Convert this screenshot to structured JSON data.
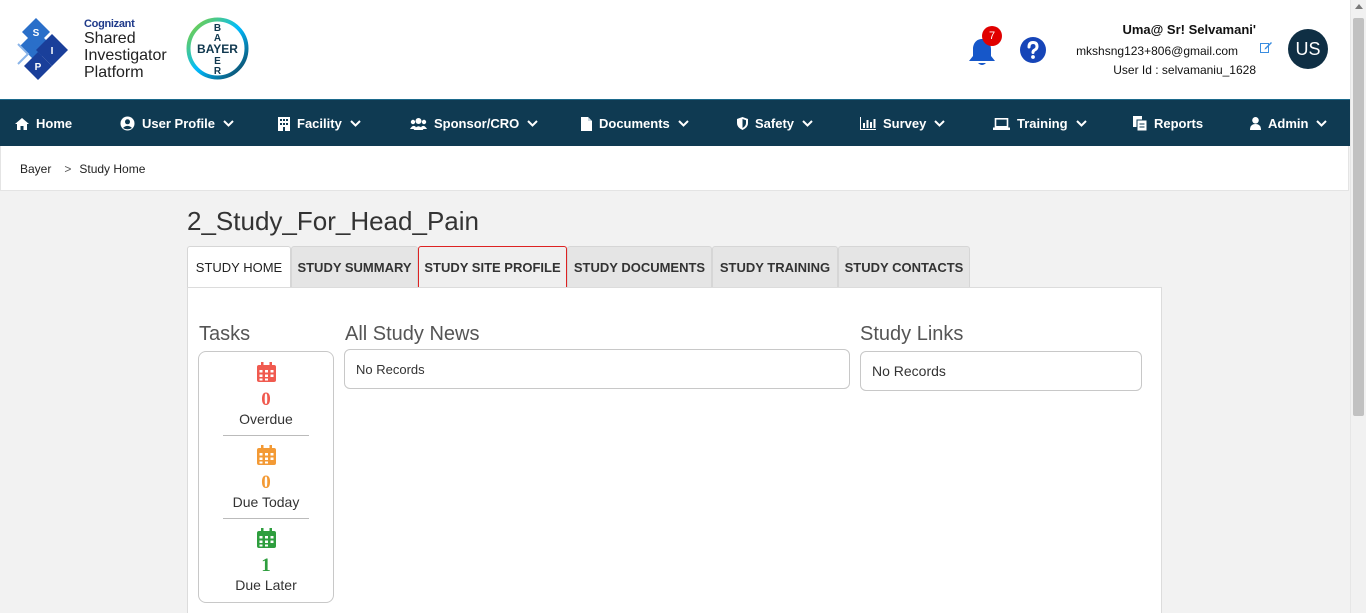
{
  "header": {
    "brand_company": "Cognizant",
    "brand_line1": "Shared",
    "brand_line2": "Investigator",
    "brand_line3": "Platform",
    "sip_letters": [
      "S",
      "I",
      "P"
    ],
    "partner_logo_text": "BAYER",
    "notification_count": "7",
    "user_name": "Uma@ Sr! Selvamani'",
    "user_email": "mkshsng123+806@gmail.com",
    "user_id": "User Id : selvamaniu_1628",
    "avatar_initials": "US"
  },
  "nav": {
    "items": [
      {
        "label": "Home",
        "icon": "home-icon",
        "dropdown": false
      },
      {
        "label": "User Profile",
        "icon": "user-circle-icon",
        "dropdown": true
      },
      {
        "label": "Facility",
        "icon": "building-icon",
        "dropdown": true
      },
      {
        "label": "Sponsor/CRO",
        "icon": "users-icon",
        "dropdown": true
      },
      {
        "label": "Documents",
        "icon": "file-icon",
        "dropdown": true
      },
      {
        "label": "Safety",
        "icon": "shield-icon",
        "dropdown": true
      },
      {
        "label": "Survey",
        "icon": "bar-chart-icon",
        "dropdown": true
      },
      {
        "label": "Training",
        "icon": "laptop-icon",
        "dropdown": true
      },
      {
        "label": "Reports",
        "icon": "copy-icon",
        "dropdown": false
      },
      {
        "label": "Admin",
        "icon": "user-icon",
        "dropdown": true
      }
    ]
  },
  "breadcrumb": {
    "root": "Bayer",
    "separator": ">",
    "current": "Study Home"
  },
  "page": {
    "title": "2_Study_For_Head_Pain",
    "tabs": [
      {
        "label": "STUDY HOME",
        "state": "active"
      },
      {
        "label": "STUDY SUMMARY",
        "state": "normal"
      },
      {
        "label": "STUDY SITE PROFILE",
        "state": "hover"
      },
      {
        "label": "STUDY DOCUMENTS",
        "state": "normal"
      },
      {
        "label": "STUDY TRAINING",
        "state": "normal"
      },
      {
        "label": "STUDY CONTACTS",
        "state": "normal"
      }
    ]
  },
  "tasks": {
    "title": "Tasks",
    "items": [
      {
        "count": "0",
        "label": "Overdue",
        "color": "#f05a4f"
      },
      {
        "count": "0",
        "label": "Due Today",
        "color": "#f39a35"
      },
      {
        "count": "1",
        "label": "Due Later",
        "color": "#2e9e3e"
      }
    ]
  },
  "news": {
    "title": "All Study News",
    "empty_text": "No Records"
  },
  "links": {
    "title": "Study Links",
    "empty_text": "No Records"
  },
  "colors": {
    "nav_bg": "#0f3a52",
    "brand_blue": "#1f3a8a",
    "tab_hover_border": "#dd2222",
    "badge_red": "#e00000"
  }
}
